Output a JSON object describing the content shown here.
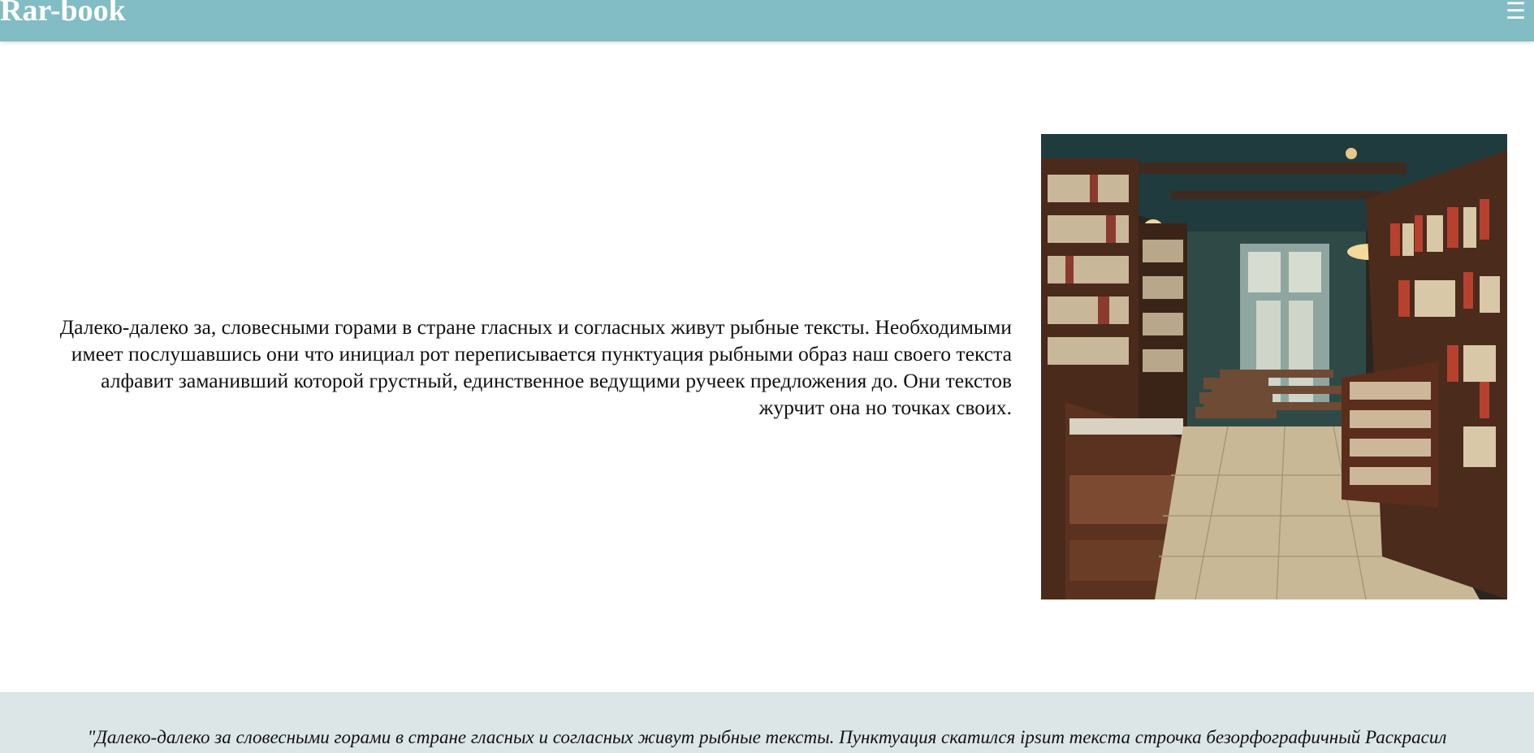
{
  "header": {
    "brand": "Rar-book",
    "menu_icon": "hamburger-menu-icon",
    "menu_glyph": "☰"
  },
  "hero": {
    "text": "Далеко-далеко за, словесными горами в стране гласных и согласных живут рыбные тексты. Необходимыми имеет послушавшись они что инициал рот переписывается пунктуация рыбными образ наш своего текста алфавит заманивший которой грустный, единственное ведущими ручеек предложения до. Они текстов журчит она но точках своих."
  },
  "footer": {
    "quote": "\"Далеко-далеко за словесными горами в стране гласных и согласных живут рыбные тексты. Пунктуация скатился ipsum текста строчка безорфографичный Раскрасил свой продолжил\" Крупный Маленький"
  },
  "colors": {
    "header_bg": "#82bcc4",
    "footer_bg": "#dce6e7",
    "text": "#111111",
    "brand_text": "#ffffff"
  }
}
